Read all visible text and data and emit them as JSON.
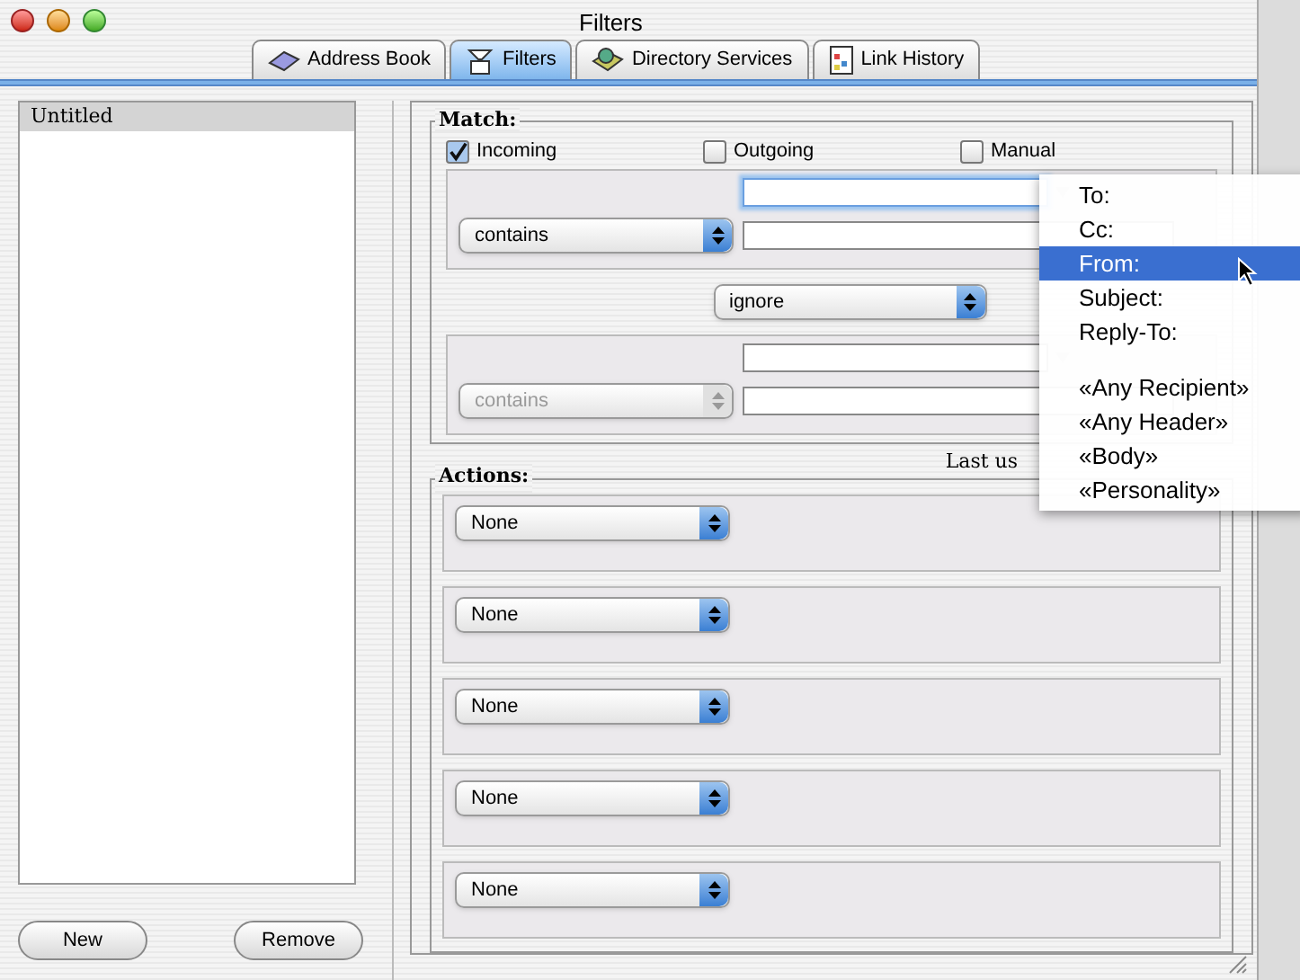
{
  "window": {
    "title": "Filters"
  },
  "tabs": [
    {
      "label": "Address Book",
      "selected": false,
      "kind": "book"
    },
    {
      "label": "Filters",
      "selected": true,
      "kind": "filter"
    },
    {
      "label": "Directory Services",
      "selected": false,
      "kind": "directory"
    },
    {
      "label": "Link History",
      "selected": false,
      "kind": "history"
    }
  ],
  "filter_list": {
    "items": [
      {
        "label": "Untitled",
        "selected": true
      }
    ]
  },
  "list_buttons": [
    "New",
    "Remove"
  ],
  "match": {
    "title": "Match:",
    "checkboxes": [
      {
        "label": "Incoming",
        "checked": true
      },
      {
        "label": "Outgoing",
        "checked": false
      },
      {
        "label": "Manual",
        "checked": false
      }
    ],
    "conditions": [
      {
        "operator": "contains",
        "disabled": false,
        "focused": true
      },
      {
        "operator": "contains",
        "disabled": true,
        "focused": false
      }
    ],
    "conjunction": "ignore"
  },
  "last_used": "Last us",
  "actions": {
    "title": "Actions:",
    "items": [
      "None",
      "None",
      "None",
      "None",
      "None"
    ]
  },
  "header_menu": {
    "items": [
      {
        "kind": "item",
        "label": "To:",
        "selected": false
      },
      {
        "kind": "item",
        "label": "Cc:",
        "selected": false
      },
      {
        "kind": "item",
        "label": "From:",
        "selected": true
      },
      {
        "kind": "item",
        "label": "Subject:",
        "selected": false
      },
      {
        "kind": "item",
        "label": "Reply-To:",
        "selected": false
      },
      {
        "kind": "separator"
      },
      {
        "kind": "item",
        "label": "«Any Recipient»",
        "selected": false
      },
      {
        "kind": "item",
        "label": "«Any Header»",
        "selected": false
      },
      {
        "kind": "item",
        "label": "«Body»",
        "selected": false
      },
      {
        "kind": "item",
        "label": "«Personality»",
        "selected": false
      }
    ]
  }
}
